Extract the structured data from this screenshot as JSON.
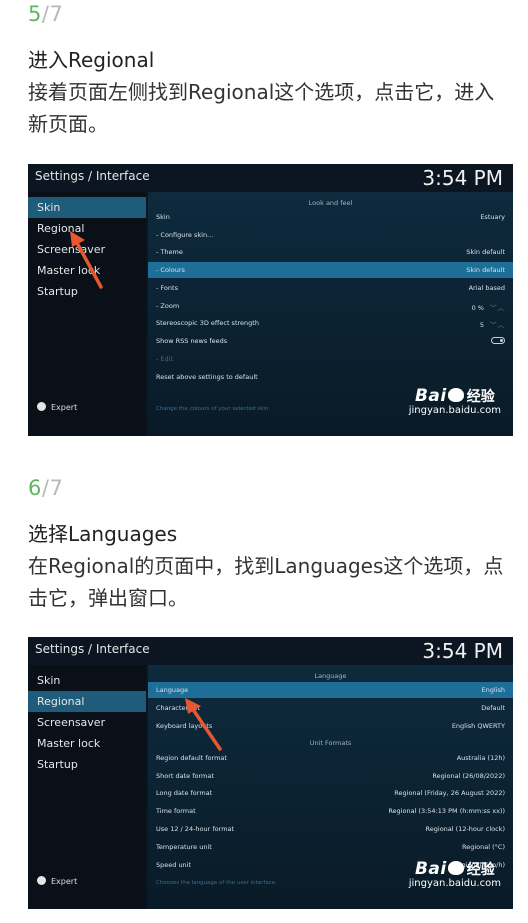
{
  "steps": [
    {
      "num": "5",
      "total": "/7",
      "title": "进入Regional",
      "desc": "接着页面左侧找到Regional这个选项，点击它，进入新页面。",
      "screenshot": {
        "breadcrumb": "Settings / Interface",
        "time": "3:54 PM",
        "sidebar": [
          "Skin",
          "Regional",
          "Screensaver",
          "Master lock",
          "Startup"
        ],
        "sidebar_active": "Skin",
        "expert_label": "Expert",
        "section_header": "Look and feel",
        "rows": [
          {
            "label": "Skin",
            "value": "Estuary"
          },
          {
            "label": "- Configure skin...",
            "value": ""
          },
          {
            "label": "- Theme",
            "value": "Skin default"
          },
          {
            "label": "- Colours",
            "value": "Skin default",
            "highlighted": true
          },
          {
            "label": "- Fonts",
            "value": "Arial based"
          },
          {
            "label": "- Zoom",
            "value": "0 %"
          },
          {
            "label": "Stereoscopic 3D effect strength",
            "value": "5"
          },
          {
            "label": "Show RSS news feeds",
            "value": ""
          },
          {
            "label": "- Edit",
            "value": "",
            "dim": true
          },
          {
            "label": "Reset above settings to default",
            "value": ""
          }
        ],
        "hint": "Change the colours of your selected skin",
        "watermark_brand": "Bai",
        "watermark_brand2": "经验",
        "watermark_url": "jingyan.baidu.com"
      }
    },
    {
      "num": "6",
      "total": "/7",
      "title": "选择Languages",
      "desc": "在Regional的页面中，找到Languages这个选项，点击它，弹出窗口。",
      "screenshot": {
        "breadcrumb": "Settings / Interface",
        "time": "3:54 PM",
        "sidebar": [
          "Skin",
          "Regional",
          "Screensaver",
          "Master lock",
          "Startup"
        ],
        "sidebar_active": "Regional",
        "expert_label": "Expert",
        "section_header": "Language",
        "section_header2": "Unit Formats",
        "rows": [
          {
            "label": "Language",
            "value": "English",
            "highlighted": true
          },
          {
            "label": "Character set",
            "value": "Default"
          },
          {
            "label": "Keyboard layouts",
            "value": "English QWERTY"
          }
        ],
        "rows2": [
          {
            "label": "Region default format",
            "value": "Australia (12h)"
          },
          {
            "label": "Short date format",
            "value": "Regional (26/08/2022)"
          },
          {
            "label": "Long date format",
            "value": "Regional (Friday, 26 August 2022)"
          },
          {
            "label": "Time format",
            "value": "Regional (3:54:13 PM (h:mm:ss xx))"
          },
          {
            "label": "Use 12 / 24-hour format",
            "value": "Regional (12-hour clock)"
          },
          {
            "label": "Temperature unit",
            "value": "Regional (°C)"
          },
          {
            "label": "Speed unit",
            "value": "Regional (km/h)"
          }
        ],
        "hint": "Chooses the language of the user interface.",
        "watermark_brand": "Bai",
        "watermark_brand2": "经验",
        "watermark_url": "jingyan.baidu.com"
      }
    }
  ],
  "colors": {
    "step_accent": "#5cb85c",
    "highlight_row": "#1d6f98",
    "sidebar_active": "#1f5b7a",
    "arrow": "#e8572f"
  }
}
